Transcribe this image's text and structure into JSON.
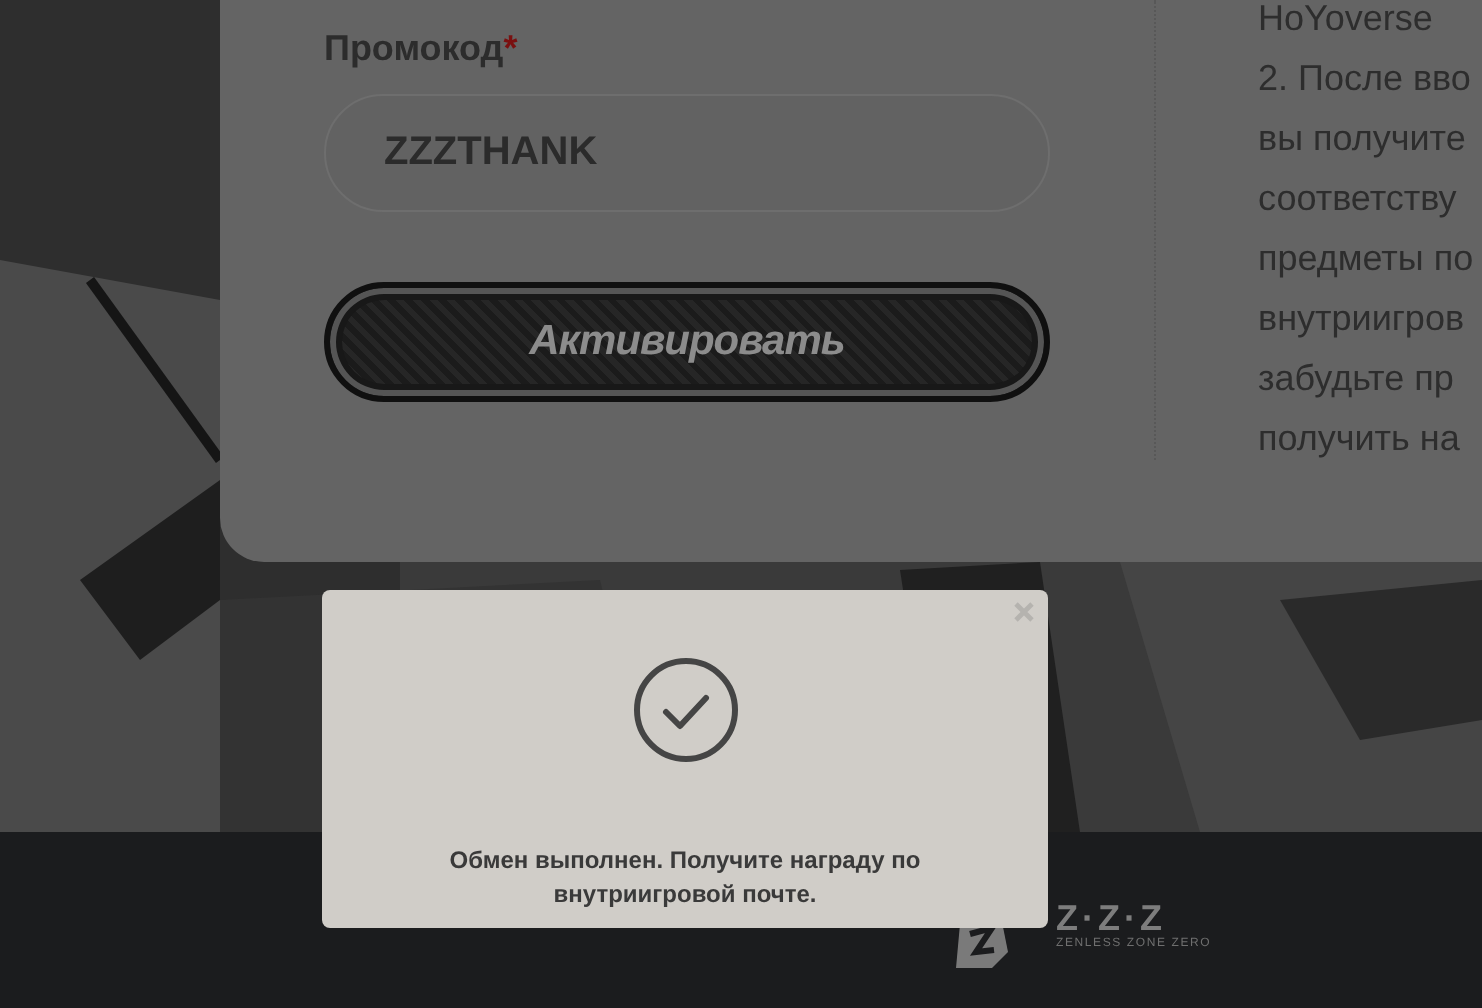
{
  "promo_form": {
    "label": "Промокод",
    "required_mark": "*",
    "value": "ZZZTHANK",
    "submit_button": "Активировать"
  },
  "instructions": {
    "lines": [
      "HoYoverse",
      "2. После вво",
      "вы получите",
      "соответству",
      "предметы по",
      "внутриигров",
      "забудьте пр",
      "получить на"
    ]
  },
  "toast": {
    "message": "Обмен выполнен. Получите награду по внутриигровой почте."
  },
  "footer": {
    "logo_title": "Z·Z·Z",
    "logo_subtitle": "ZENLESS ZONE ZERO"
  }
}
